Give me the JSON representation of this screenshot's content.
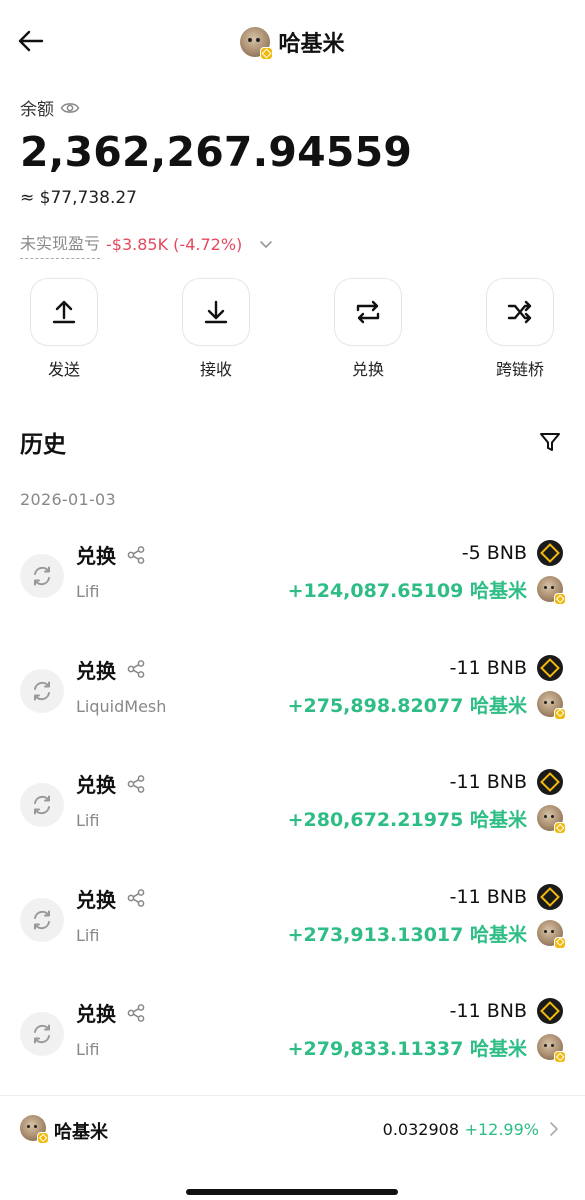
{
  "header": {
    "title": "哈基米"
  },
  "balance": {
    "label": "余额",
    "amount": "2,362,267.94559",
    "usd": "≈ $77,738.27",
    "pnl_label": "未实现盈亏",
    "pnl_value": "-$3.85K (-4.72%)"
  },
  "actions": [
    {
      "label": "发送",
      "icon": "upload-arrow-icon"
    },
    {
      "label": "接收",
      "icon": "download-arrow-icon"
    },
    {
      "label": "兑换",
      "icon": "swap-arrows-icon"
    },
    {
      "label": "跨链桥",
      "icon": "shuffle-icon"
    }
  ],
  "history": {
    "title": "历史",
    "date": "2026-01-03",
    "items": [
      {
        "type": "兑换",
        "provider": "Lifi",
        "out": "-5 BNB",
        "in": "+124,087.65109 哈基米"
      },
      {
        "type": "兑换",
        "provider": "LiquidMesh",
        "out": "-11 BNB",
        "in": "+275,898.82077 哈基米"
      },
      {
        "type": "兑换",
        "provider": "Lifi",
        "out": "-11 BNB",
        "in": "+280,672.21975 哈基米"
      },
      {
        "type": "兑换",
        "provider": "Lifi",
        "out": "-11 BNB",
        "in": "+273,913.13017 哈基米"
      },
      {
        "type": "兑换",
        "provider": "Lifi",
        "out": "-11 BNB",
        "in": "+279,833.11337 哈基米"
      }
    ]
  },
  "footer": {
    "token_name": "哈基米",
    "price": "0.032908",
    "change": "+12.99%"
  },
  "colors": {
    "positive": "#2ebd85",
    "negative": "#e5495e",
    "bnb_yellow": "#f0b90b"
  }
}
